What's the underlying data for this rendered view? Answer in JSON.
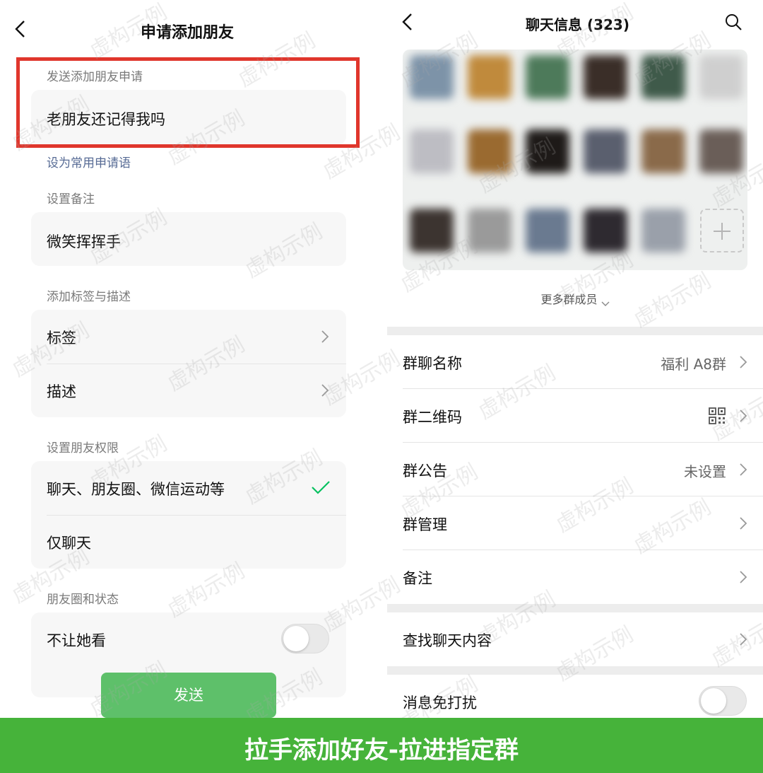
{
  "left_panel": {
    "title": "申请添加朋友",
    "request_section_label": "发送添加朋友申请",
    "request_message": "老朋友还记得我吗",
    "set_common_phrase_link": "设为常用申请语",
    "remark_section_label": "设置备注",
    "remark_value": "微笑挥挥手",
    "tags_section_label": "添加标签与描述",
    "tag_label": "标签",
    "description_label": "描述",
    "permission_section_label": "设置朋友权限",
    "permission_options": [
      {
        "label": "聊天、朋友圈、微信运动等",
        "selected": true
      },
      {
        "label": "仅聊天",
        "selected": false
      }
    ],
    "moments_section_label": "朋友圈和状态",
    "hide_moments_label": "不让她看",
    "hide_moments_on": false,
    "send_button_label": "发送",
    "highlight_color": "#e0362c"
  },
  "right_panel": {
    "title": "聊天信息 (323)",
    "more_members_label": "更多群成员",
    "settings_rows": [
      {
        "label": "群聊名称",
        "value": "福利 A8群",
        "icon": ""
      },
      {
        "label": "群二维码",
        "value": "",
        "icon": "qr-code-icon"
      },
      {
        "label": "群公告",
        "value": "未设置",
        "icon": ""
      },
      {
        "label": "群管理",
        "value": "",
        "icon": ""
      },
      {
        "label": "备注",
        "value": "",
        "icon": ""
      }
    ],
    "search_chat_label": "查找聊天内容",
    "mute_label": "消息免打扰",
    "mute_on": false,
    "avatar_colors": [
      "#7d93a8",
      "#c08a3c",
      "#4d7a5a",
      "#3a2e28",
      "#3f5a4a",
      "#cfcfcf",
      "#bdbdc3",
      "#9a6a30",
      "#1e1a18",
      "#5a5f6e",
      "#8a6a4a",
      "#6a5e58",
      "#3c3430",
      "#9a9a9a",
      "#6a7a90",
      "#2e2a30",
      "#9aa0aa"
    ]
  },
  "watermark_text": "虚构示例",
  "banner_text": "拉手添加好友-拉进指定群",
  "colors": {
    "accent_green": "#5ec06a",
    "banner_green": "#46b33a",
    "link_blue": "#576b95",
    "check_green": "#07c160"
  }
}
